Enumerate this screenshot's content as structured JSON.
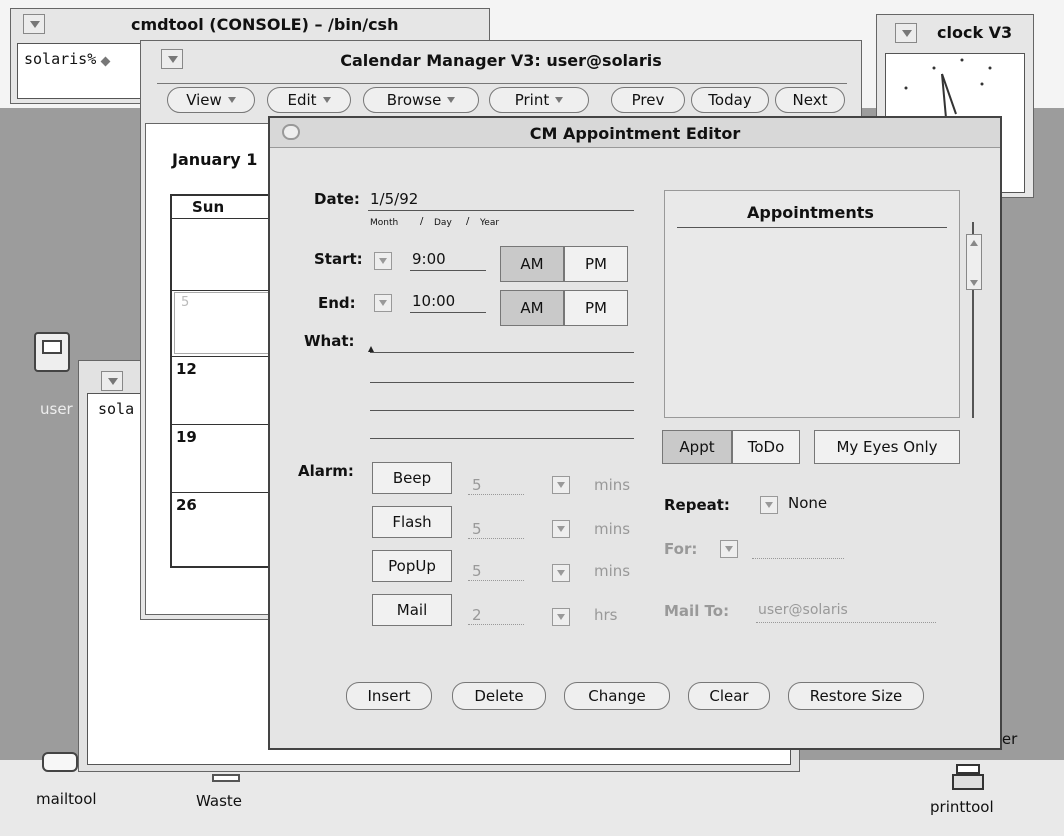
{
  "cmdtool": {
    "title": "cmdtool (CONSOLE) – /bin/csh",
    "prompt": "solaris%"
  },
  "clock": {
    "title": "clock V3"
  },
  "calendar": {
    "title": "Calendar Manager V3: user@solaris",
    "menus": [
      "View",
      "Edit",
      "Browse",
      "Print"
    ],
    "nav": [
      "Prev",
      "Today",
      "Next"
    ],
    "month_label": "January 1",
    "day_header": "Sun",
    "dates": [
      "5",
      "12",
      "19",
      "26"
    ]
  },
  "background_shell": {
    "prompt": "sola"
  },
  "editor": {
    "title": "CM Appointment Editor",
    "date_label": "Date:",
    "date_value": "1/5/92",
    "date_hint_month": "Month",
    "date_hint_day": "Day",
    "date_hint_year": "Year",
    "date_hint_sep": "/",
    "start_label": "Start:",
    "start_value": "9:00",
    "end_label": "End:",
    "end_value": "10:00",
    "am": "AM",
    "pm": "PM",
    "what_label": "What:",
    "alarm_label": "Alarm:",
    "alarms": [
      {
        "name": "Beep",
        "value": "5",
        "unit": "mins"
      },
      {
        "name": "Flash",
        "value": "5",
        "unit": "mins"
      },
      {
        "name": "PopUp",
        "value": "5",
        "unit": "mins"
      },
      {
        "name": "Mail",
        "value": "2",
        "unit": "hrs"
      }
    ],
    "appointments_header": "Appointments",
    "appt": "Appt",
    "todo": "ToDo",
    "my_eyes_only": "My Eyes Only",
    "repeat_label": "Repeat:",
    "repeat_value": "None",
    "for_label": "For:",
    "mail_to_label": "Mail To:",
    "mail_to_value": "user@solaris",
    "buttons": [
      "Insert",
      "Delete",
      "Change",
      "Clear",
      "Restore Size"
    ]
  },
  "desktop": {
    "icon_user": "user",
    "icon_mailtool": "mailtool",
    "icon_waste": "Waste",
    "icon_printtool": "printtool",
    "partial_text": "ter"
  }
}
